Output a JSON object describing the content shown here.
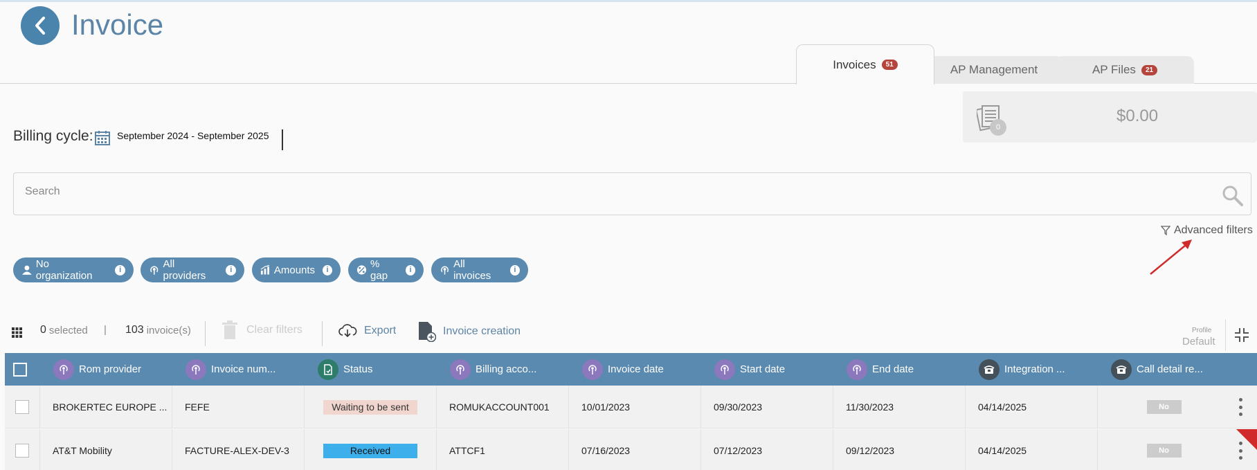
{
  "header": {
    "title": "Invoice",
    "back_label": "Back"
  },
  "tabs": [
    {
      "label": "Invoices",
      "badge": "51",
      "active": true
    },
    {
      "label": "AP Management",
      "badge": "",
      "active": false
    },
    {
      "label": "AP Files",
      "badge": "21",
      "active": false
    }
  ],
  "summary": {
    "count": "0",
    "amount": "$0.00"
  },
  "billing": {
    "label": "Billing cycle:",
    "value": "September 2024 - September 2025"
  },
  "search": {
    "placeholder": "Search"
  },
  "advanced_filters_label": "Advanced filters",
  "filters": [
    {
      "label": "No organization",
      "icon": "organization-icon"
    },
    {
      "label": "All providers",
      "icon": "antenna-icon"
    },
    {
      "label": "Amounts",
      "icon": "chart-icon"
    },
    {
      "label": "% gap",
      "icon": "percent-icon"
    },
    {
      "label": "All invoices",
      "icon": "antenna-icon"
    }
  ],
  "toolbar": {
    "selected_count": "0",
    "selected_label": "selected",
    "separator": "|",
    "invoice_count": "103",
    "invoice_label": "invoice(s)",
    "clear_filters": "Clear filters",
    "export": "Export",
    "invoice_creation": "Invoice creation",
    "profile_label": "Profile",
    "profile_value": "Default"
  },
  "table": {
    "columns": [
      {
        "label": "Rom provider",
        "icon": "antenna-icon"
      },
      {
        "label": "Invoice num...",
        "icon": "antenna-icon"
      },
      {
        "label": "Status",
        "icon": "document-icon"
      },
      {
        "label": "Billing acco...",
        "icon": "antenna-icon"
      },
      {
        "label": "Invoice date",
        "icon": "antenna-icon"
      },
      {
        "label": "Start date",
        "icon": "antenna-icon"
      },
      {
        "label": "End date",
        "icon": "antenna-icon"
      },
      {
        "label": "Integration ...",
        "icon": "phone-icon"
      },
      {
        "label": "Call detail re...",
        "icon": "phone-icon"
      }
    ],
    "rows": [
      {
        "provider": "BROKERTEC EUROPE ...",
        "invoice_num": "FEFE",
        "status": "Waiting to be sent",
        "billing_account": "ROMUKACCOUNT001",
        "invoice_date": "10/01/2023",
        "start_date": "09/30/2023",
        "end_date": "11/30/2023",
        "integration": "04/14/2025",
        "call_detail": "No"
      },
      {
        "provider": "AT&T Mobility",
        "invoice_num": "FACTURE-ALEX-DEV-3",
        "status": "Received",
        "billing_account": "ATTCF1",
        "invoice_date": "07/16/2023",
        "start_date": "07/12/2023",
        "end_date": "09/12/2023",
        "integration": "04/14/2025",
        "call_detail": "No"
      }
    ]
  },
  "colors": {
    "primary": "#5a8aaf",
    "badge": "#b5443c",
    "status_waiting": "#f0d6cf",
    "status_received": "#3db0ec",
    "column_icon": "#8b78bd",
    "arrow": "#d12a2a"
  }
}
